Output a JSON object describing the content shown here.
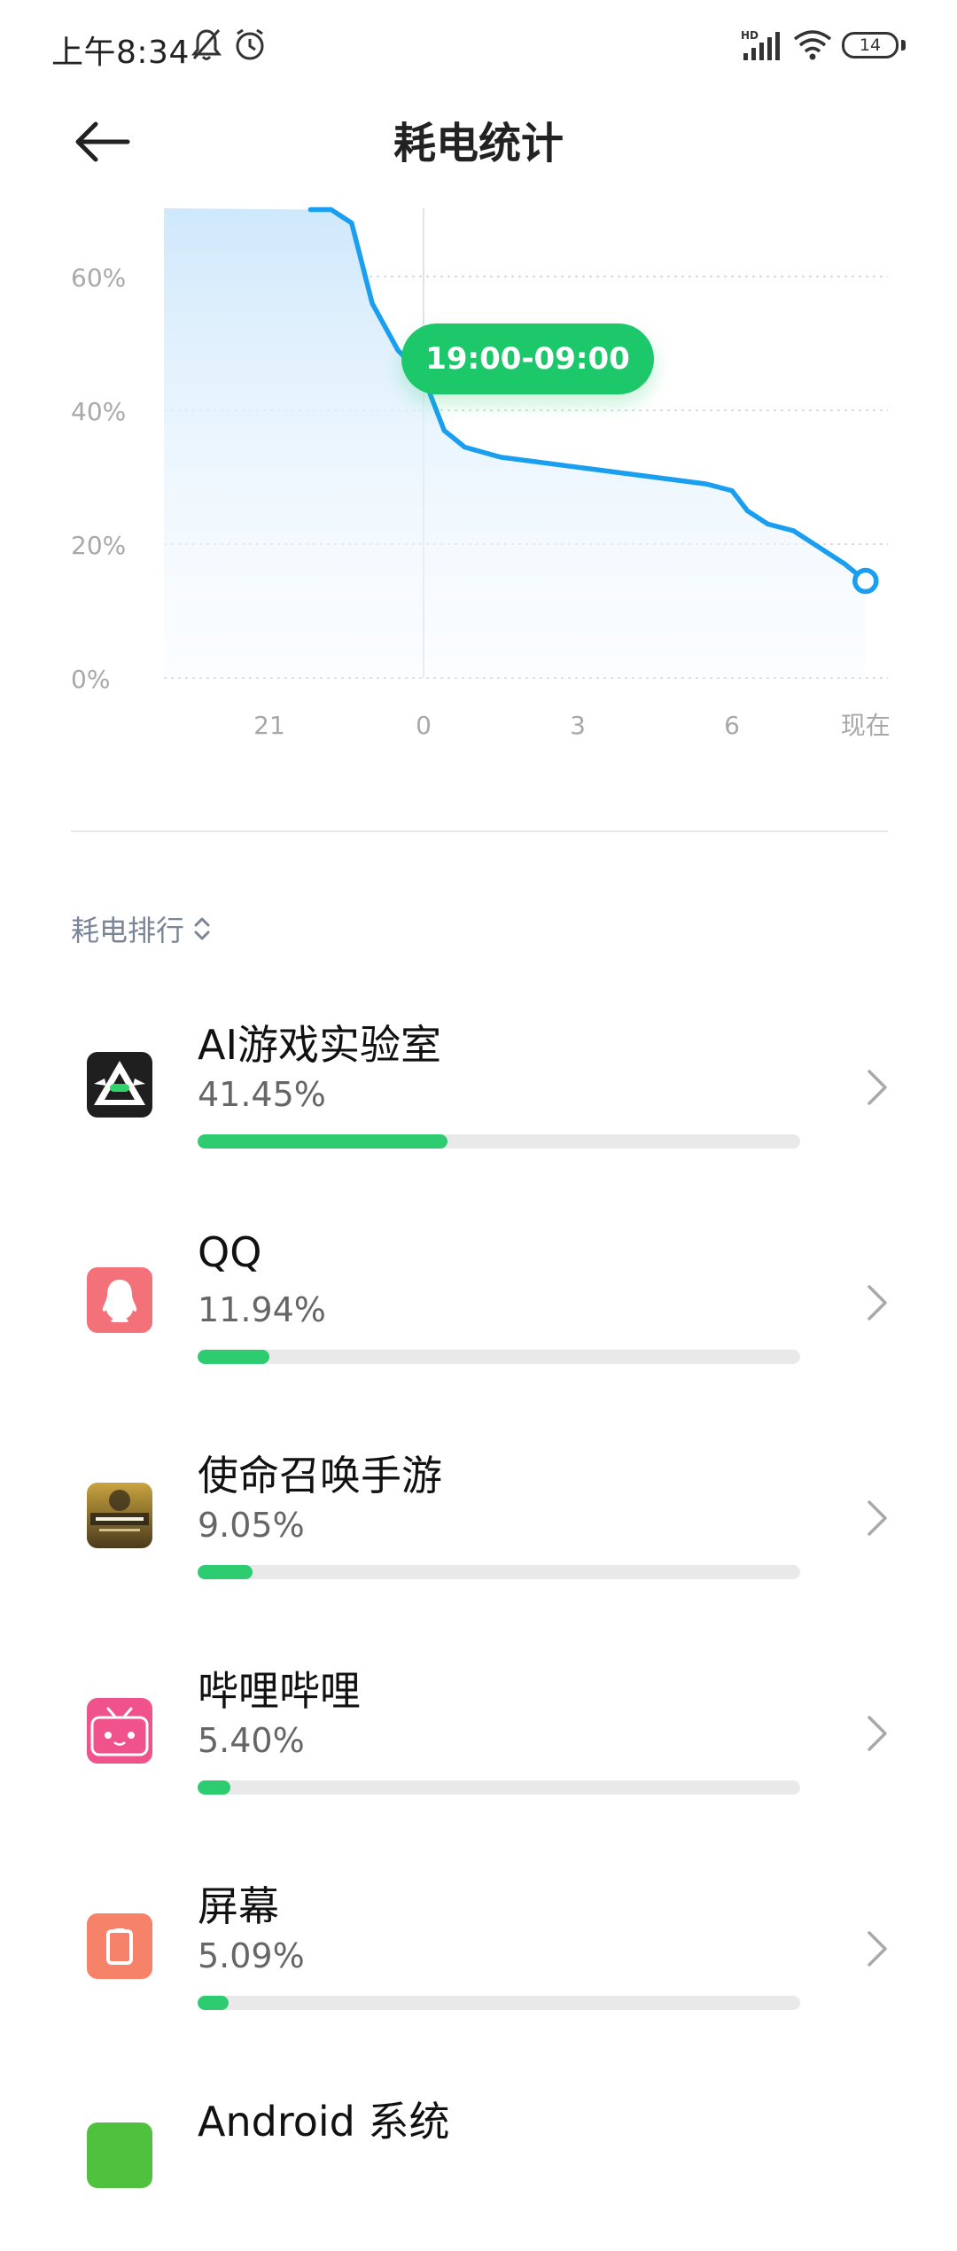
{
  "status": {
    "time": "上午8:34",
    "battery": "14",
    "icons": [
      "mute-bell-icon",
      "alarm-icon",
      "hd-signal-icon",
      "wifi-icon",
      "battery-icon"
    ]
  },
  "header": {
    "title": "耗电统计",
    "back_icon": "arrow-left-icon"
  },
  "chart_data": {
    "type": "area",
    "y_ticks": [
      "60%",
      "40%",
      "20%",
      "0%"
    ],
    "x_ticks": [
      "21",
      "0",
      "3",
      "6",
      "现在"
    ],
    "ylim": [
      0,
      70
    ],
    "highlight_label": "19:00-09:00",
    "series": [
      {
        "values": [
          {
            "x": -2.2,
            "y": 70
          },
          {
            "x": -1.8,
            "y": 70
          },
          {
            "x": -1.4,
            "y": 68
          },
          {
            "x": -1.0,
            "y": 56
          },
          {
            "x": -0.5,
            "y": 49
          },
          {
            "x": 0.0,
            "y": 45
          },
          {
            "x": 0.4,
            "y": 37
          },
          {
            "x": 0.8,
            "y": 34.5
          },
          {
            "x": 1.5,
            "y": 33
          },
          {
            "x": 3.5,
            "y": 31
          },
          {
            "x": 5.5,
            "y": 29
          },
          {
            "x": 6.0,
            "y": 28
          },
          {
            "x": 6.3,
            "y": 25
          },
          {
            "x": 6.7,
            "y": 23
          },
          {
            "x": 7.2,
            "y": 22
          },
          {
            "x": 8.2,
            "y": 17
          },
          {
            "x": 8.6,
            "y": 14.5
          }
        ]
      }
    ],
    "colors": {
      "line": "#1a9ef0",
      "badge": "#1dc86a"
    }
  },
  "ranking": {
    "label": "耗电排行",
    "sort_icon": "sort-updown-icon"
  },
  "apps": [
    {
      "name": "AI游戏实验室",
      "pct_label": "41.45%",
      "pct": 41.45,
      "icon": "ai-lab-app-icon"
    },
    {
      "name": "QQ",
      "pct_label": "11.94%",
      "pct": 11.94,
      "icon": "qq-app-icon"
    },
    {
      "name": "使命召唤手游",
      "pct_label": "9.05%",
      "pct": 9.05,
      "icon": "call-of-duty-app-icon"
    },
    {
      "name": "哔哩哔哩",
      "pct_label": "5.40%",
      "pct": 5.4,
      "icon": "bilibili-app-icon"
    },
    {
      "name": "屏幕",
      "pct_label": "5.09%",
      "pct": 5.09,
      "icon": "screen-icon"
    },
    {
      "name": "Android 系统",
      "pct_label": "",
      "pct": null,
      "icon": "android-system-icon"
    }
  ]
}
